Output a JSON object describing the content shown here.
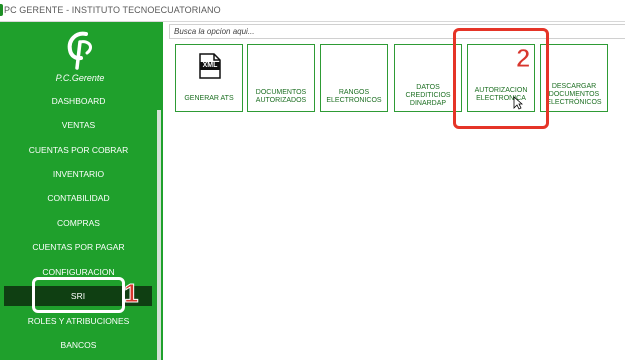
{
  "window": {
    "title": "PC GERENTE - INSTITUTO TECNOECUATORIANO"
  },
  "logo": {
    "mark": "Ç",
    "name": "P.C.Gerente"
  },
  "sidebar": {
    "items": [
      {
        "label": "DASHBOARD"
      },
      {
        "label": "VENTAS"
      },
      {
        "label": "CUENTAS POR COBRAR"
      },
      {
        "label": "INVENTARIO"
      },
      {
        "label": "CONTABILIDAD"
      },
      {
        "label": "COMPRAS"
      },
      {
        "label": "CUENTAS POR PAGAR"
      },
      {
        "label": "CONFIGURACION"
      },
      {
        "label": "SRI"
      },
      {
        "label": "ROLES Y ATRIBUCIONES"
      },
      {
        "label": "BANCOS"
      }
    ],
    "active": "SRI"
  },
  "search": {
    "placeholder": "Busca la opcion aqui..."
  },
  "tiles": [
    {
      "label": "GENERAR ATS",
      "icon": "xml-file-icon",
      "icon_text": "XML"
    },
    {
      "label": "DOCUMENTOS AUTORIZADOS"
    },
    {
      "label": "RANGOS ELECTRONICOS"
    },
    {
      "label": "DATOS CREDITICIOS DINARDAP"
    },
    {
      "label": "AUTORIZACION ELECTRONICA"
    },
    {
      "label": "DESCARGAR DOCUMENTOS ELECTRÓNICOS"
    }
  ],
  "annotations": {
    "step1": "1",
    "step2": "2"
  },
  "colors": {
    "sidebar_bg": "#1fa02c",
    "active_bg": "#0f3f12",
    "tile_border": "#2e9b35",
    "annotation_red": "#e53427"
  }
}
